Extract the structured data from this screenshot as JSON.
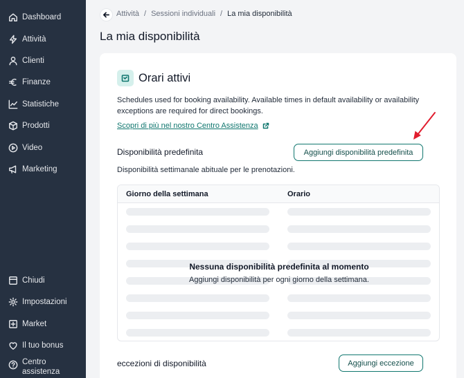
{
  "sidebar": {
    "top_items": [
      {
        "label": "Dashboard",
        "icon": "home-icon"
      },
      {
        "label": "Attività",
        "icon": "bolt-icon"
      },
      {
        "label": "Clienti",
        "icon": "user-icon"
      },
      {
        "label": "Finanze",
        "icon": "euro-icon"
      },
      {
        "label": "Statistiche",
        "icon": "chart-icon"
      },
      {
        "label": "Prodotti",
        "icon": "box-icon"
      },
      {
        "label": "Video",
        "icon": "play-icon"
      },
      {
        "label": "Marketing",
        "icon": "megaphone-icon"
      }
    ],
    "bottom_items": [
      {
        "label": "Chiudi",
        "icon": "panel-icon"
      },
      {
        "label": "Impostazioni",
        "icon": "gear-icon"
      },
      {
        "label": "Market",
        "icon": "plus-square-icon"
      },
      {
        "label": "Il tuo bonus",
        "icon": "heart-icon"
      },
      {
        "label": "Centro assistenza",
        "icon": "help-icon"
      }
    ]
  },
  "breadcrumb": {
    "items": [
      "Attività",
      "Sessioni individuali",
      "La mia disponibilità"
    ],
    "separator": "/"
  },
  "page": {
    "title": "La mia disponibilità"
  },
  "card": {
    "title": "Orari attivi",
    "description": "Schedules used for booking availability. Available times in default availability or availability exceptions are required for direct bookings.",
    "help_link": "Scopri di più nel nostro Centro Assistenza",
    "default_section": {
      "title": "Disponibilità predefinita",
      "button": "Aggiungi disponibilità predefinita",
      "subtitle": "Disponibilità settimanale abituale per le prenotazioni."
    },
    "table": {
      "columns": [
        "Giorno della settimana",
        "Orario"
      ],
      "empty_title": "Nessuna disponibilità predefinita al momento",
      "empty_subtitle": "Aggiungi disponibilità per ogni giorno della settimana."
    },
    "exceptions_section": {
      "title": "eccezioni di disponibilità",
      "button": "Aggiungi eccezione"
    }
  },
  "colors": {
    "sidebar_bg": "#263141",
    "accent": "#0f766e",
    "annotation_arrow": "#e11d2e"
  }
}
